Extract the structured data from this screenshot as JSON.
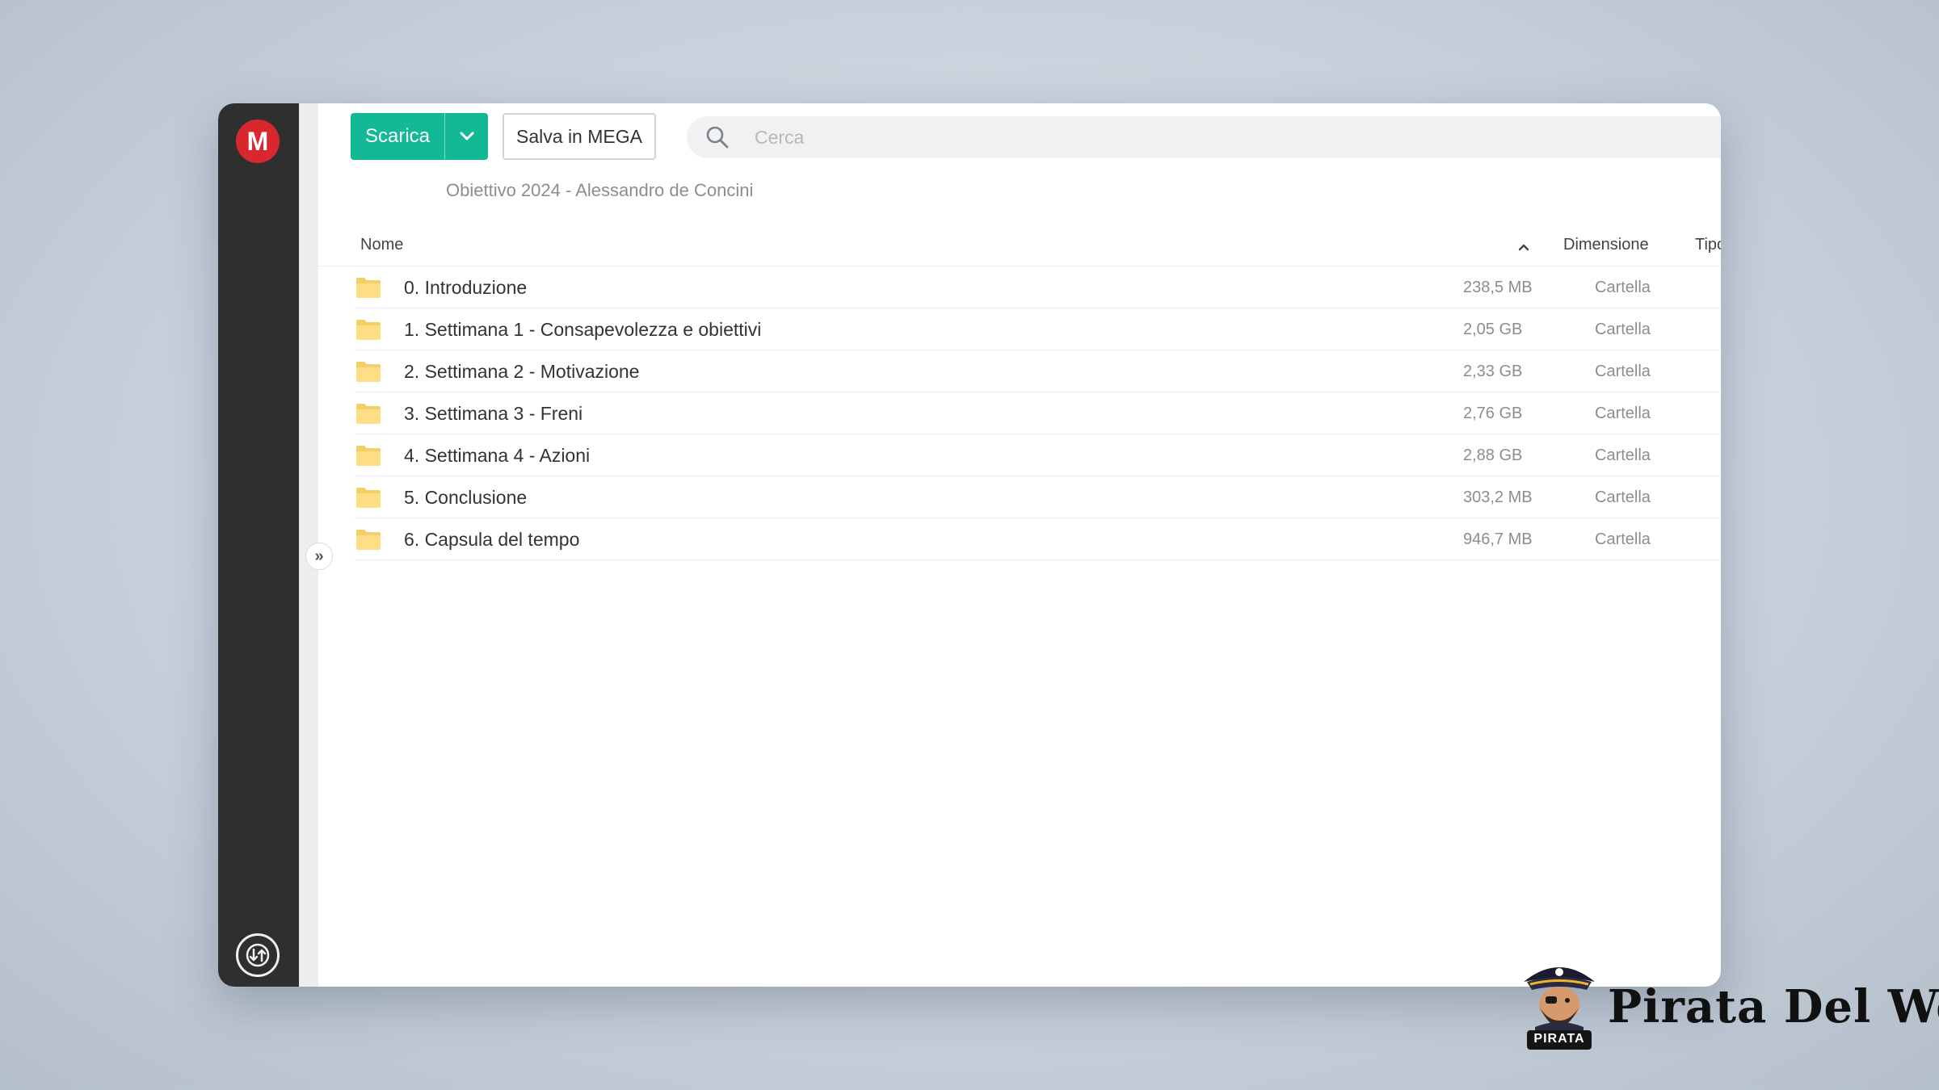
{
  "app": {
    "logo_letter": "M",
    "accent_color": "#13b894",
    "logo_color": "#d9272e"
  },
  "toolbar": {
    "download_label": "Scarica",
    "save_label": "Salva in MEGA"
  },
  "search": {
    "placeholder": "Cerca"
  },
  "breadcrumb": {
    "path": "Obiettivo 2024 - Alessandro de Concini"
  },
  "table": {
    "columns": {
      "name": "Nome",
      "size": "Dimensione",
      "type": "Tipo"
    },
    "rows": [
      {
        "name": "0. Introduzione",
        "size": "238,5 MB",
        "type": "Cartella"
      },
      {
        "name": "1. Settimana 1 - Consapevolezza e obiettivi",
        "size": "2,05 GB",
        "type": "Cartella"
      },
      {
        "name": "2. Settimana 2 - Motivazione",
        "size": "2,33 GB",
        "type": "Cartella"
      },
      {
        "name": "3. Settimana 3 - Freni",
        "size": "2,76 GB",
        "type": "Cartella"
      },
      {
        "name": "4. Settimana 4 - Azioni",
        "size": "2,88 GB",
        "type": "Cartella"
      },
      {
        "name": "5. Conclusione",
        "size": "303,2 MB",
        "type": "Cartella"
      },
      {
        "name": "6. Capsula del tempo",
        "size": "946,7 MB",
        "type": "Cartella"
      }
    ]
  },
  "watermark": {
    "brand_name": "Pirata Del Web",
    "mascot_label": "PIRATA"
  }
}
